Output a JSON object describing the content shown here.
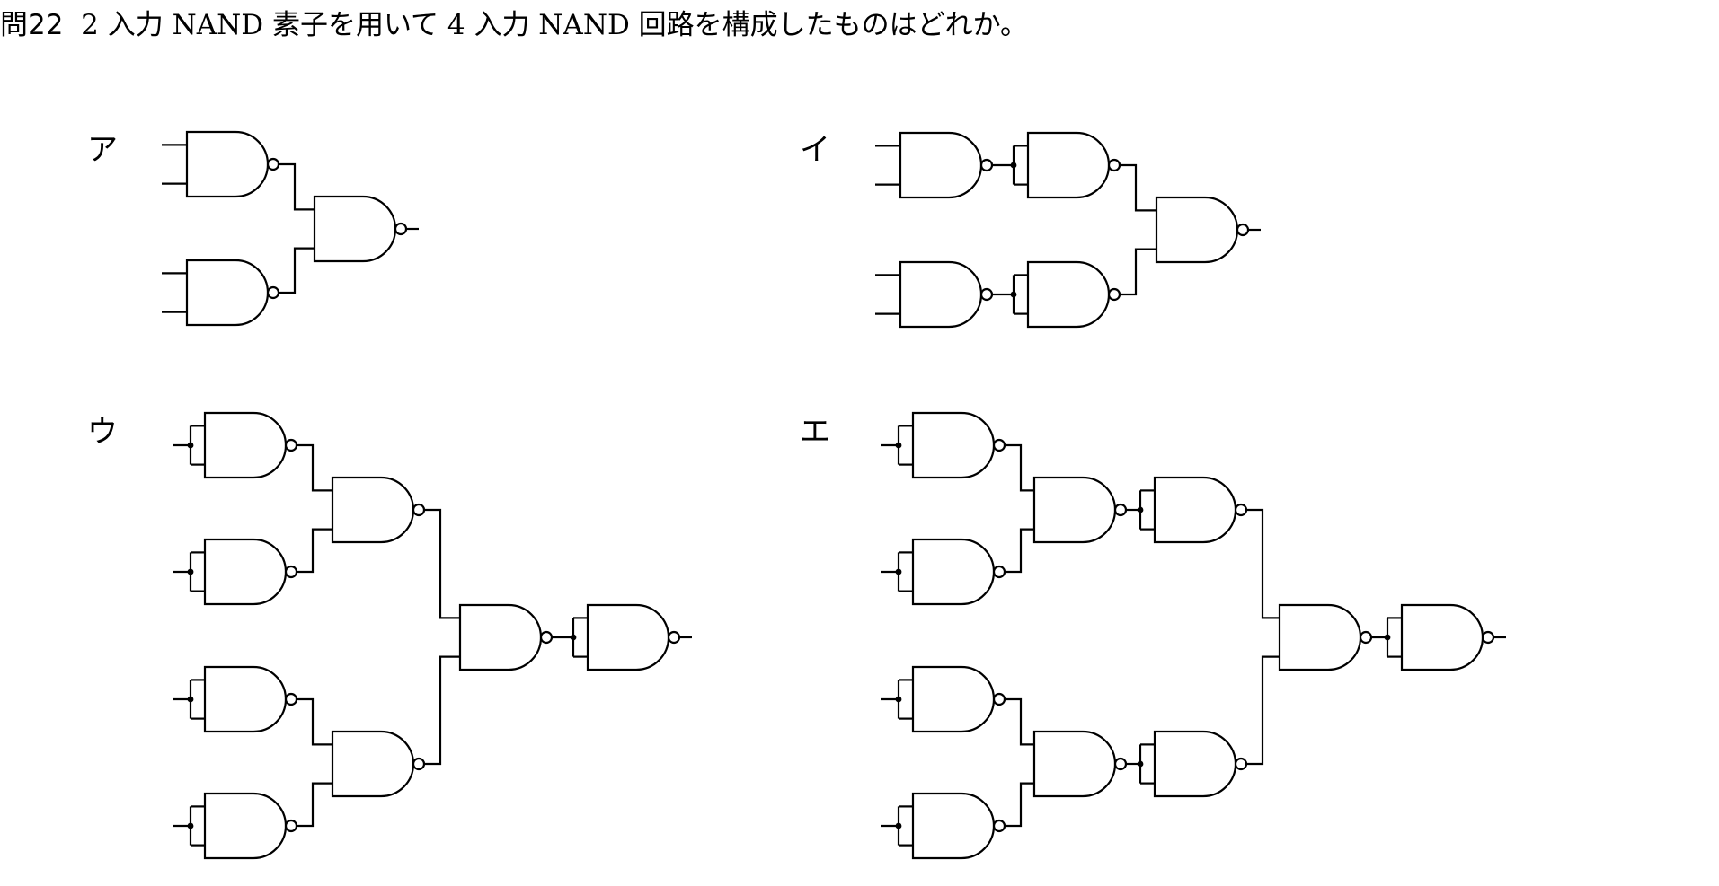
{
  "question": {
    "number": "問22",
    "text": "2 入力 NAND 素子を用いて 4 入力 NAND 回路を構成したものはどれか。"
  },
  "options": [
    {
      "label": "ア"
    },
    {
      "label": "イ"
    },
    {
      "label": "ウ"
    },
    {
      "label": "エ"
    }
  ]
}
